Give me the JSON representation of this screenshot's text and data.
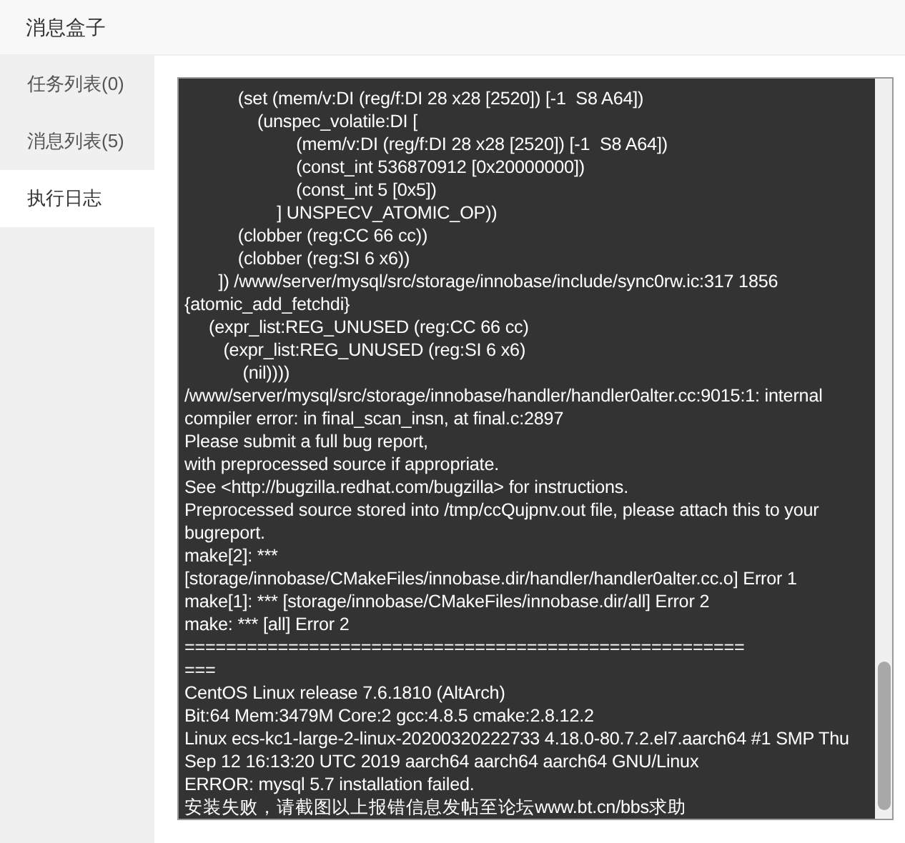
{
  "window": {
    "title": "消息盒子"
  },
  "tabs": [
    {
      "label": "任务列表(0)",
      "selected": false
    },
    {
      "label": "消息列表(5)",
      "selected": false
    },
    {
      "label": "执行日志",
      "selected": true
    }
  ],
  "log": {
    "lines": [
      "           (set (mem/v:DI (reg/f:DI 28 x28 [2520]) [-1  S8 A64])",
      "               (unspec_volatile:DI [",
      "                       (mem/v:DI (reg/f:DI 28 x28 [2520]) [-1  S8 A64])",
      "                       (const_int 536870912 [0x20000000])",
      "                       (const_int 5 [0x5])",
      "                   ] UNSPECV_ATOMIC_OP))",
      "           (clobber (reg:CC 66 cc))",
      "           (clobber (reg:SI 6 x6))",
      "       ]) /www/server/mysql/src/storage/innobase/include/sync0rw.ic:317 1856",
      "{atomic_add_fetchdi}",
      "     (expr_list:REG_UNUSED (reg:CC 66 cc)",
      "        (expr_list:REG_UNUSED (reg:SI 6 x6)",
      "            (nil))))",
      "/www/server/mysql/src/storage/innobase/handler/handler0alter.cc:9015:1: internal",
      "compiler error: in final_scan_insn, at final.c:2897",
      "Please submit a full bug report,",
      "with preprocessed source if appropriate.",
      "See <http://bugzilla.redhat.com/bugzilla> for instructions.",
      "Preprocessed source stored into /tmp/ccQujpnv.out file, please attach this to your",
      "bugreport.",
      "make[2]: ***",
      "[storage/innobase/CMakeFiles/innobase.dir/handler/handler0alter.cc.o] Error 1",
      "make[1]: *** [storage/innobase/CMakeFiles/innobase.dir/all] Error 2",
      "make: *** [all] Error 2",
      "======================================================",
      "===",
      "CentOS Linux release 7.6.1810 (AltArch)",
      "Bit:64 Mem:3479M Core:2 gcc:4.8.5 cmake:2.8.12.2",
      "Linux ecs-kc1-large-2-linux-20200320222733 4.18.0-80.7.2.el7.aarch64 #1 SMP Thu",
      "Sep 12 16:13:20 UTC 2019 aarch64 aarch64 aarch64 GNU/Linux",
      "ERROR: mysql 5.7 installation failed.",
      "安装失败，请截图以上报错信息发帖至论坛www.bt.cn/bbs求助"
    ]
  }
}
